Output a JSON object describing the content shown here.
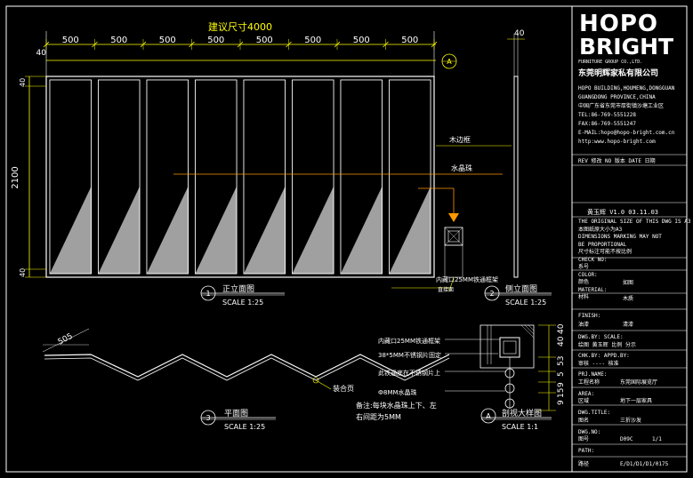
{
  "dimensions": {
    "top_title": "建议尺寸4000",
    "panel_widths": [
      "500",
      "500",
      "500",
      "500",
      "500",
      "500",
      "500",
      "500"
    ],
    "left_margin": "40",
    "side_margin": "40",
    "height": "2100",
    "top_40": "40",
    "bottom_40": "40",
    "plan_segment": "505",
    "detail_dims": [
      "40",
      "40",
      "53",
      "5",
      "9",
      "15",
      "9"
    ]
  },
  "markers": {
    "section_a": "A",
    "view1_num": "1",
    "view2_num": "2",
    "view3_num": "3",
    "detail_a": "A"
  },
  "labels": {
    "wood_edge": "木边框",
    "crystal": "水晶珠",
    "inner_frame": "内藏口25MM铁通框架",
    "outer_frame": "直接面",
    "view1_title": "正立面图",
    "view1_scale": "SCALE 1:25",
    "view2_title": "侧立面图",
    "view2_scale": "SCALE 1:25",
    "view3_title": "平面图",
    "view3_scale": "SCALE 1:25",
    "detailA_title": "剖视大样图",
    "detailA_scale": "SCALE 1:1",
    "hinge": "装合页",
    "note_line1": "备注:每块水晶珠上下、左",
    "note_line2": "右间距为5MM",
    "d_note1": "内藏口25MM铁通框架",
    "d_note2": "38*5MM不锈钢片固定",
    "d_note3": "此铁通底在不锈钢片上",
    "d_note4": "Ф8MM水晶珠"
  },
  "titleblock": {
    "logo_top": "HOPO",
    "logo_bottom": "BRIGHT",
    "company_en": "FURNITURE GROUP CO.,LTD.",
    "company_cn": "东莞明辉家私有限公司",
    "address_lines": [
      "HOPO BUILDING,HOUMENG,DONGGUAN",
      "GUANGDONG PROVINCE,CHINA",
      "中国广东省东莞市厚街镇沙塘工业区",
      "TEL:86-769-5551228",
      "FAX:86-769-5551247",
      "E-MAIL:hopo@hopo-bright.com.cn",
      "http:www.hopo-bright.com"
    ],
    "rev_header": "REV 修改   NO 版本   DATE 日期",
    "designer_line": "黄玉辉   V1.0   03.11.03",
    "disclaimer": [
      "THE ORIGINAL SIZE OF THIS DWG IS A3",
      "本图纸原大小为A3",
      "DIMENSIONS MARKING MAY NOT",
      "BE PROPORTIONAL",
      "尺寸标注可能不按比例",
      "CHECK NO:",
      "系号",
      "COLOR:",
      "颜色",
      "MATERIAL:",
      "材料"
    ],
    "color_val": "如图",
    "material_val": "木质",
    "finish_label": "FINISH:",
    "finish_cn": "油漆",
    "finish_val": "清漆",
    "dwg_row": "DWG.BY:   SCALE:",
    "dwg_row_cn": "绘图   黄玉辉   比例   分示",
    "chk_row": "CHK.BY:   APPD.BY:",
    "chk_row_cn": "审核   ----   核准",
    "prj_name_label": "PRJ.NAME:",
    "prj_name_cn": "工程名称",
    "prj_name_val": "东莞国际展览厅",
    "area_label": "AREA:",
    "area_cn": "区域",
    "area_val": "地下一层家具",
    "title_label": "DWG.TITLE:",
    "title_cn": "图名",
    "title_val": "三折沙发",
    "dwgno_label": "DWG.NO:",
    "dwgno_cn": "图号",
    "dwgno_val": "D09C",
    "sheet_val": "1/1",
    "path_label": "PATH:",
    "path_cn": "路径",
    "path_val": "E/D1/D1/D1/0175"
  },
  "colors": {
    "background": "#000000",
    "outline": "#ffffff",
    "dimension": "#ffff00",
    "leader": "#ffff00",
    "panel_gray": "#a0a0a0",
    "marker_orange": "#ff9900"
  }
}
